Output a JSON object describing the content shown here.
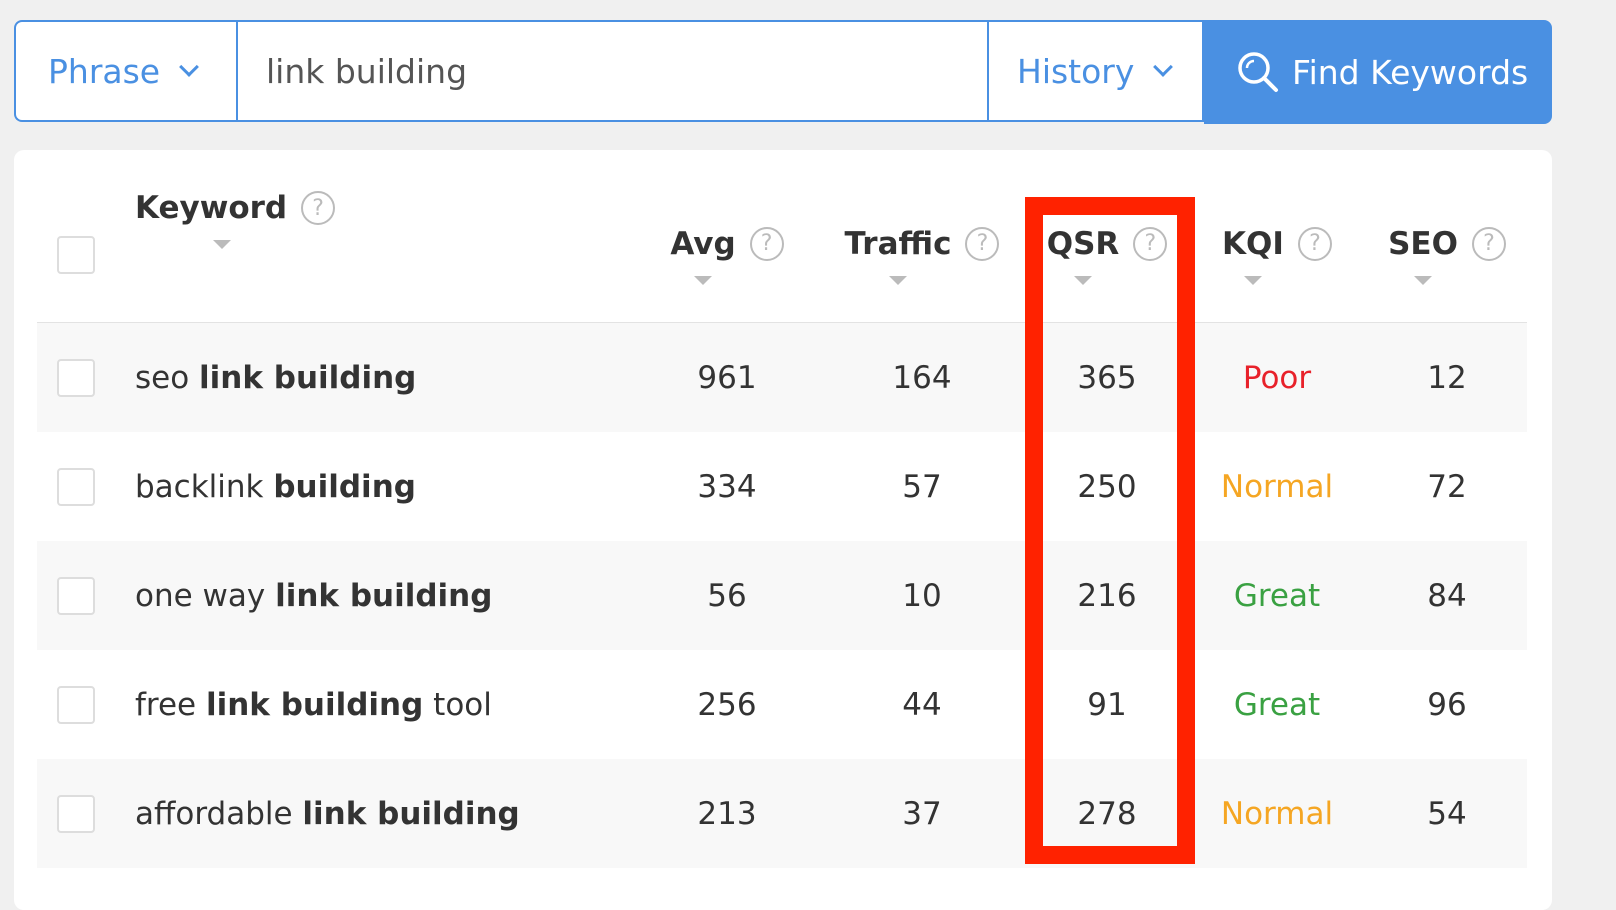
{
  "search": {
    "mode": "Phrase",
    "query": "link building",
    "history": "History",
    "find_label": "Find Keywords",
    "accent": "#4a90e2"
  },
  "table": {
    "headers": {
      "keyword": "Keyword",
      "avg": "Avg",
      "traffic": "Traffic",
      "qsr": "QSR",
      "kqi": "KQI",
      "seo": "SEO",
      "help": "?"
    },
    "rows": [
      {
        "pre": "seo ",
        "bold": "link building",
        "post": "",
        "avg": "961",
        "traffic": "164",
        "qsr": "365",
        "kqi": "Poor",
        "kqi_color": "#e8212a",
        "seo": "12"
      },
      {
        "pre": "backlink ",
        "bold": "building",
        "post": "",
        "avg": "334",
        "traffic": "57",
        "qsr": "250",
        "kqi": "Normal",
        "kqi_color": "#f5a623",
        "seo": "72"
      },
      {
        "pre": "one way ",
        "bold": "link building",
        "post": "",
        "avg": "56",
        "traffic": "10",
        "qsr": "216",
        "kqi": "Great",
        "kqi_color": "#3aa142",
        "seo": "84"
      },
      {
        "pre": "free ",
        "bold": "link building",
        "post": " tool",
        "avg": "256",
        "traffic": "44",
        "qsr": "91",
        "kqi": "Great",
        "kqi_color": "#3aa142",
        "seo": "96"
      },
      {
        "pre": "affordable ",
        "bold": "link building",
        "post": "",
        "avg": "213",
        "traffic": "37",
        "qsr": "278",
        "kqi": "Normal",
        "kqi_color": "#f5a623",
        "seo": "54"
      }
    ]
  },
  "highlight_color": "#ff2200"
}
